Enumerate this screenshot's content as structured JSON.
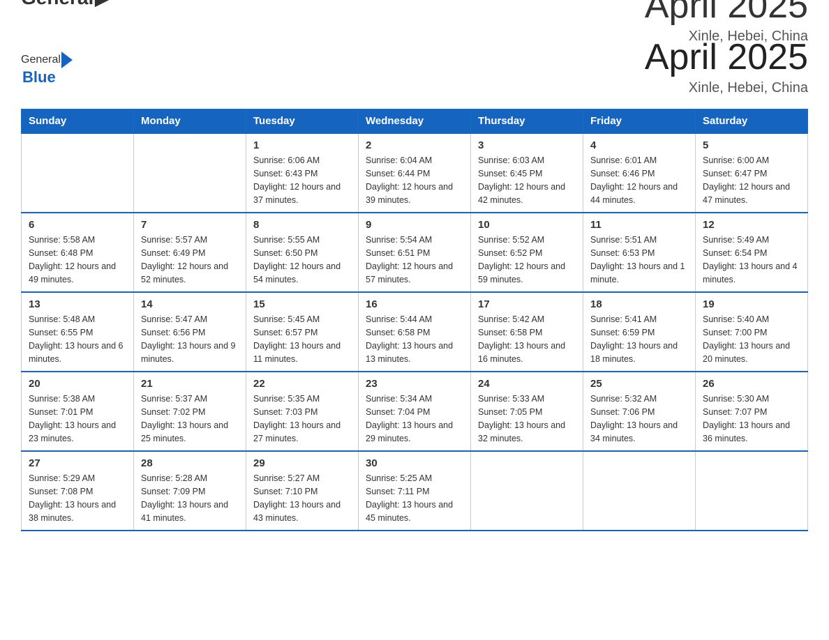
{
  "header": {
    "logo": {
      "general": "General",
      "blue": "Blue",
      "subtitle": "Blue"
    },
    "title": "April 2025",
    "location": "Xinle, Hebei, China"
  },
  "days_of_week": [
    "Sunday",
    "Monday",
    "Tuesday",
    "Wednesday",
    "Thursday",
    "Friday",
    "Saturday"
  ],
  "weeks": [
    {
      "days": [
        {
          "number": "",
          "info": ""
        },
        {
          "number": "",
          "info": ""
        },
        {
          "number": "1",
          "info": "Sunrise: 6:06 AM\nSunset: 6:43 PM\nDaylight: 12 hours\nand 37 minutes."
        },
        {
          "number": "2",
          "info": "Sunrise: 6:04 AM\nSunset: 6:44 PM\nDaylight: 12 hours\nand 39 minutes."
        },
        {
          "number": "3",
          "info": "Sunrise: 6:03 AM\nSunset: 6:45 PM\nDaylight: 12 hours\nand 42 minutes."
        },
        {
          "number": "4",
          "info": "Sunrise: 6:01 AM\nSunset: 6:46 PM\nDaylight: 12 hours\nand 44 minutes."
        },
        {
          "number": "5",
          "info": "Sunrise: 6:00 AM\nSunset: 6:47 PM\nDaylight: 12 hours\nand 47 minutes."
        }
      ]
    },
    {
      "days": [
        {
          "number": "6",
          "info": "Sunrise: 5:58 AM\nSunset: 6:48 PM\nDaylight: 12 hours\nand 49 minutes."
        },
        {
          "number": "7",
          "info": "Sunrise: 5:57 AM\nSunset: 6:49 PM\nDaylight: 12 hours\nand 52 minutes."
        },
        {
          "number": "8",
          "info": "Sunrise: 5:55 AM\nSunset: 6:50 PM\nDaylight: 12 hours\nand 54 minutes."
        },
        {
          "number": "9",
          "info": "Sunrise: 5:54 AM\nSunset: 6:51 PM\nDaylight: 12 hours\nand 57 minutes."
        },
        {
          "number": "10",
          "info": "Sunrise: 5:52 AM\nSunset: 6:52 PM\nDaylight: 12 hours\nand 59 minutes."
        },
        {
          "number": "11",
          "info": "Sunrise: 5:51 AM\nSunset: 6:53 PM\nDaylight: 13 hours\nand 1 minute."
        },
        {
          "number": "12",
          "info": "Sunrise: 5:49 AM\nSunset: 6:54 PM\nDaylight: 13 hours\nand 4 minutes."
        }
      ]
    },
    {
      "days": [
        {
          "number": "13",
          "info": "Sunrise: 5:48 AM\nSunset: 6:55 PM\nDaylight: 13 hours\nand 6 minutes."
        },
        {
          "number": "14",
          "info": "Sunrise: 5:47 AM\nSunset: 6:56 PM\nDaylight: 13 hours\nand 9 minutes."
        },
        {
          "number": "15",
          "info": "Sunrise: 5:45 AM\nSunset: 6:57 PM\nDaylight: 13 hours\nand 11 minutes."
        },
        {
          "number": "16",
          "info": "Sunrise: 5:44 AM\nSunset: 6:58 PM\nDaylight: 13 hours\nand 13 minutes."
        },
        {
          "number": "17",
          "info": "Sunrise: 5:42 AM\nSunset: 6:58 PM\nDaylight: 13 hours\nand 16 minutes."
        },
        {
          "number": "18",
          "info": "Sunrise: 5:41 AM\nSunset: 6:59 PM\nDaylight: 13 hours\nand 18 minutes."
        },
        {
          "number": "19",
          "info": "Sunrise: 5:40 AM\nSunset: 7:00 PM\nDaylight: 13 hours\nand 20 minutes."
        }
      ]
    },
    {
      "days": [
        {
          "number": "20",
          "info": "Sunrise: 5:38 AM\nSunset: 7:01 PM\nDaylight: 13 hours\nand 23 minutes."
        },
        {
          "number": "21",
          "info": "Sunrise: 5:37 AM\nSunset: 7:02 PM\nDaylight: 13 hours\nand 25 minutes."
        },
        {
          "number": "22",
          "info": "Sunrise: 5:35 AM\nSunset: 7:03 PM\nDaylight: 13 hours\nand 27 minutes."
        },
        {
          "number": "23",
          "info": "Sunrise: 5:34 AM\nSunset: 7:04 PM\nDaylight: 13 hours\nand 29 minutes."
        },
        {
          "number": "24",
          "info": "Sunrise: 5:33 AM\nSunset: 7:05 PM\nDaylight: 13 hours\nand 32 minutes."
        },
        {
          "number": "25",
          "info": "Sunrise: 5:32 AM\nSunset: 7:06 PM\nDaylight: 13 hours\nand 34 minutes."
        },
        {
          "number": "26",
          "info": "Sunrise: 5:30 AM\nSunset: 7:07 PM\nDaylight: 13 hours\nand 36 minutes."
        }
      ]
    },
    {
      "days": [
        {
          "number": "27",
          "info": "Sunrise: 5:29 AM\nSunset: 7:08 PM\nDaylight: 13 hours\nand 38 minutes."
        },
        {
          "number": "28",
          "info": "Sunrise: 5:28 AM\nSunset: 7:09 PM\nDaylight: 13 hours\nand 41 minutes."
        },
        {
          "number": "29",
          "info": "Sunrise: 5:27 AM\nSunset: 7:10 PM\nDaylight: 13 hours\nand 43 minutes."
        },
        {
          "number": "30",
          "info": "Sunrise: 5:25 AM\nSunset: 7:11 PM\nDaylight: 13 hours\nand 45 minutes."
        },
        {
          "number": "",
          "info": ""
        },
        {
          "number": "",
          "info": ""
        },
        {
          "number": "",
          "info": ""
        }
      ]
    }
  ]
}
